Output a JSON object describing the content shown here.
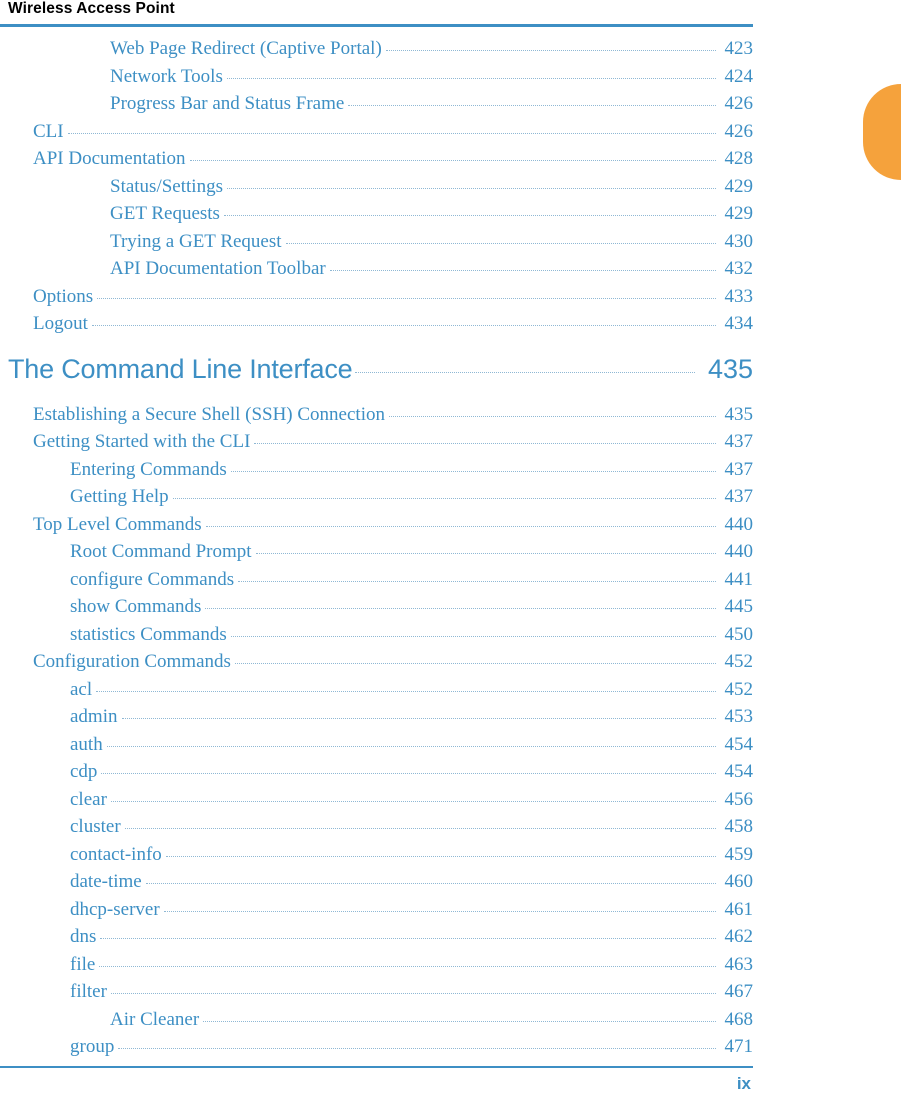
{
  "header": {
    "title": "Wireless Access Point"
  },
  "footer": {
    "page_number": "ix"
  },
  "colors": {
    "accent": "#3d8fc4",
    "tab": "#f5a23c",
    "leader": "#8fb8d4"
  },
  "toc": {
    "entries": [
      {
        "label": "Web Page Redirect (Captive Portal)",
        "page": "423",
        "level": 3
      },
      {
        "label": "Network Tools",
        "page": "424",
        "level": 3
      },
      {
        "label": "Progress Bar and Status Frame",
        "page": "426",
        "level": 3
      },
      {
        "label": "CLI",
        "page": "426",
        "level": 1
      },
      {
        "label": "API Documentation",
        "page": "428",
        "level": 1
      },
      {
        "label": "Status/Settings",
        "page": "429",
        "level": 3
      },
      {
        "label": "GET Requests",
        "page": "429",
        "level": 3
      },
      {
        "label": "Trying a GET Request",
        "page": "430",
        "level": 3
      },
      {
        "label": "API Documentation Toolbar",
        "page": "432",
        "level": 3
      },
      {
        "label": "Options",
        "page": "433",
        "level": 1
      },
      {
        "label": "Logout",
        "page": "434",
        "level": 1
      },
      {
        "label": "The Command Line Interface",
        "page": "435",
        "level": 0
      },
      {
        "label": "Establishing a Secure Shell (SSH) Connection",
        "page": "435",
        "level": 1
      },
      {
        "label": "Getting Started with the CLI",
        "page": "437",
        "level": 1
      },
      {
        "label": "Entering Commands",
        "page": "437",
        "level": 2
      },
      {
        "label": "Getting Help",
        "page": "437",
        "level": 2
      },
      {
        "label": "Top Level Commands",
        "page": "440",
        "level": 1
      },
      {
        "label": "Root Command Prompt",
        "page": "440",
        "level": 2
      },
      {
        "label": "configure Commands",
        "page": "441",
        "level": 2
      },
      {
        "label": "show Commands",
        "page": "445",
        "level": 2
      },
      {
        "label": "statistics Commands",
        "page": "450",
        "level": 2
      },
      {
        "label": "Configuration Commands",
        "page": "452",
        "level": 1
      },
      {
        "label": "acl",
        "page": "452",
        "level": 2
      },
      {
        "label": "admin",
        "page": "453",
        "level": 2
      },
      {
        "label": "auth",
        "page": "454",
        "level": 2
      },
      {
        "label": "cdp",
        "page": "454",
        "level": 2
      },
      {
        "label": "clear",
        "page": "456",
        "level": 2
      },
      {
        "label": "cluster",
        "page": "458",
        "level": 2
      },
      {
        "label": "contact-info",
        "page": "459",
        "level": 2
      },
      {
        "label": "date-time",
        "page": "460",
        "level": 2
      },
      {
        "label": "dhcp-server",
        "page": "461",
        "level": 2
      },
      {
        "label": "dns",
        "page": "462",
        "level": 2
      },
      {
        "label": "file",
        "page": "463",
        "level": 2
      },
      {
        "label": "filter",
        "page": "467",
        "level": 2
      },
      {
        "label": "Air Cleaner",
        "page": "468",
        "level": 3
      },
      {
        "label": "group",
        "page": "471",
        "level": 2
      }
    ]
  }
}
